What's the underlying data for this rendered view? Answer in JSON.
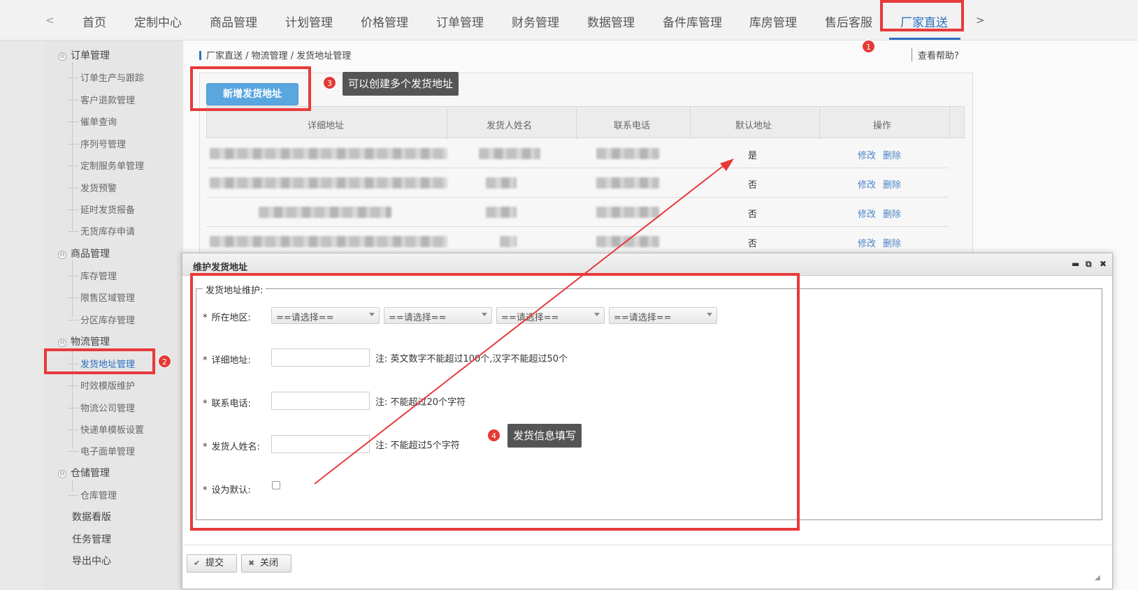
{
  "nav": {
    "prev": "<",
    "next": ">",
    "items": [
      "首页",
      "定制中心",
      "商品管理",
      "计划管理",
      "价格管理",
      "订单管理",
      "财务管理",
      "数据管理",
      "备件库管理",
      "库房管理",
      "售后客服",
      "厂家直送"
    ]
  },
  "sidebar": {
    "groups": [
      {
        "label": "订单管理",
        "toggle": "⊖",
        "children": [
          "订单生产与跟踪",
          "客户退款管理",
          "催单查询",
          "序列号管理",
          "定制服务单管理",
          "发货预警",
          "延时发货报备",
          "无货库存申请"
        ]
      },
      {
        "label": "商品管理",
        "toggle": "⊖",
        "children": [
          "库存管理",
          "限售区域管理",
          "分区库存管理"
        ]
      },
      {
        "label": "物流管理",
        "toggle": "⊖",
        "children": [
          "发货地址管理",
          "时效模版维护",
          "物流公司管理",
          "快递单模板设置",
          "电子面单管理"
        ]
      },
      {
        "label": "仓储管理",
        "toggle": "⊖",
        "children": [
          "仓库管理"
        ]
      }
    ],
    "plain": [
      "数据看版",
      "任务管理",
      "导出中心"
    ]
  },
  "breadcrumb": "厂家直送 / 物流管理 / 发货地址管理",
  "help": "查看帮助?",
  "add_button": "新增发货地址",
  "table": {
    "headers": [
      "详细地址",
      "发货人姓名",
      "联系电话",
      "默认地址",
      "操作"
    ],
    "rows": [
      {
        "default": "是",
        "edit": "修改",
        "delete": "删除"
      },
      {
        "default": "否",
        "edit": "修改",
        "delete": "删除"
      },
      {
        "default": "否",
        "edit": "修改",
        "delete": "删除"
      },
      {
        "default": "否",
        "edit": "修改",
        "delete": "删除"
      }
    ]
  },
  "dialog": {
    "title": "维护发货地址",
    "legend": "发货地址维护:",
    "region_label": "所在地区:",
    "region_options": [
      "==请选择==",
      "==请选择==",
      "==请选择==",
      "==请选择=="
    ],
    "address_label": "详细地址:",
    "address_note": "注: 英文数字不能超过100个,汉字不能超过50个",
    "phone_label": "联系电话:",
    "phone_note": "注: 不能超过20个字符",
    "name_label": "发货人姓名:",
    "name_note": "注: 不能超过5个字符",
    "default_label": "设为默认:",
    "star": "*",
    "controls": {
      "minimize": "▬",
      "maximize": "⧉",
      "close": "✖"
    },
    "submit": "提交",
    "close": "关闭",
    "resize_icon": "◢"
  },
  "annotations": {
    "badges": [
      "1",
      "2",
      "3",
      "4"
    ],
    "tip3": "可以创建多个发货地址",
    "tip4": "发货信息填写",
    "color": "#e83a3a"
  }
}
